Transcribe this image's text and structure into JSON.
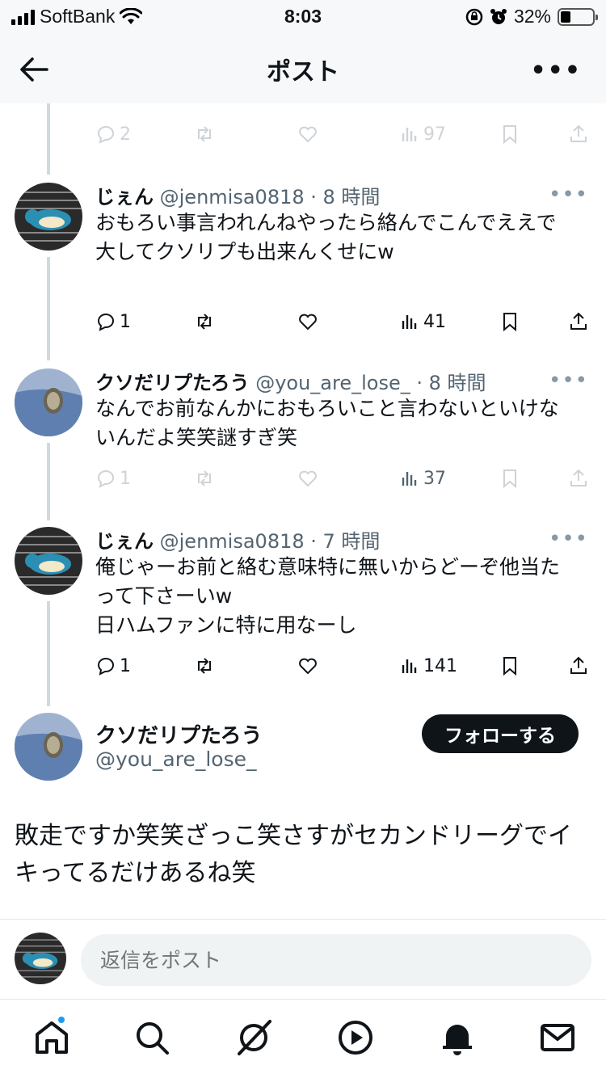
{
  "status_bar": {
    "carrier": "SoftBank",
    "time": "8:03",
    "battery": "32%"
  },
  "header": {
    "title": "ポスト"
  },
  "top_actions": {
    "replies": "2",
    "views": "97"
  },
  "tweets": [
    {
      "name": "じぇん",
      "meta": "@jenmisa0818 · 8 時間",
      "text": "おもろい事言われんねやったら絡んでこんでええで\n大してクソリプも出来んくせにw",
      "replies": "1",
      "views": "41"
    },
    {
      "name": "クソだリプたろう",
      "meta": "@you_are_lose_ · 8 時間",
      "text": "なんでお前なんかにおもろいこと言わないといけないんだよ笑笑謎すぎ笑",
      "replies": "1",
      "views": "37"
    },
    {
      "name": "じぇん",
      "meta": "@jenmisa0818 · 7 時間",
      "text": "俺じゃーお前と絡む意味特に無いからどーぞ他当たって下さーいw\n日ハムファンに特に用なーし",
      "replies": "1",
      "views": "141"
    }
  ],
  "main_post": {
    "name": "クソだリプたろう",
    "handle": "@you_are_lose_",
    "follow_label": "フォローする",
    "text": "敗走ですか笑笑ざっこ笑さすがセカンドリーグでイキってるだけあるね笑"
  },
  "reply_bar": {
    "placeholder": "返信をポスト"
  },
  "tab_bar": [
    "home-icon",
    "search-icon",
    "grok-icon",
    "video-icon",
    "notifications-icon",
    "messages-icon"
  ],
  "colors": {
    "accent": "#1d9bf0",
    "text": "#0f1419",
    "muted": "#536471"
  }
}
